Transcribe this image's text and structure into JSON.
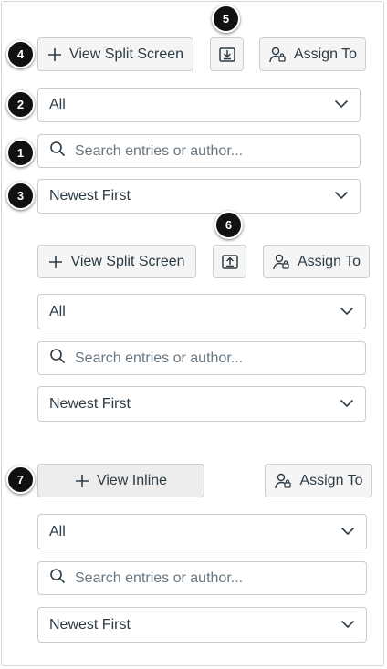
{
  "callouts": [
    "1",
    "2",
    "3",
    "4",
    "5",
    "6",
    "7"
  ],
  "section1": {
    "split_label": "View Split Screen",
    "assign_label": "Assign To",
    "filter_value": "All",
    "search_placeholder": "Search entries or author...",
    "sort_value": "Newest First",
    "toggle_icon": "download-tray-icon"
  },
  "section2": {
    "split_label": "View Split Screen",
    "assign_label": "Assign To",
    "filter_value": "All",
    "search_placeholder": "Search entries or author...",
    "sort_value": "Newest First",
    "toggle_icon": "upload-tray-icon"
  },
  "section3": {
    "inline_label": "View Inline",
    "assign_label": "Assign To",
    "filter_value": "All",
    "search_placeholder": "Search entries or author...",
    "sort_value": "Newest First"
  },
  "icons": {
    "plus": "plus-icon",
    "assign": "user-assign-icon",
    "search": "search-icon",
    "chevron": "chevron-down-icon"
  }
}
